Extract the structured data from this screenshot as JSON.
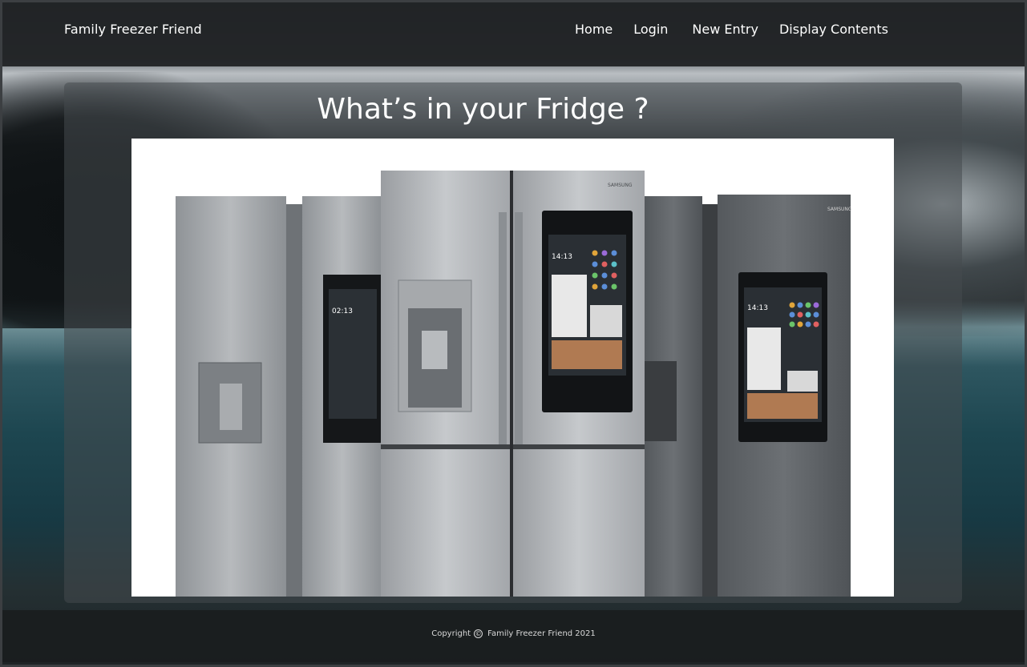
{
  "navbar": {
    "brand": "Family Freezer Friend",
    "links": [
      "Home",
      "Login",
      "New Entry",
      "Display Contents"
    ]
  },
  "main": {
    "title": "What’s in your Fridge ?",
    "hero_image": {
      "alt": "Samsung smart fridges",
      "brand_text": "SAMSUNG",
      "screen_time_left": "02:13",
      "screen_time_center": "14:13",
      "screen_time_right": "14:13"
    }
  },
  "footer": {
    "prefix": "Copyright",
    "copyright_symbol": "©",
    "text": "Family Freezer Friend 2021"
  }
}
